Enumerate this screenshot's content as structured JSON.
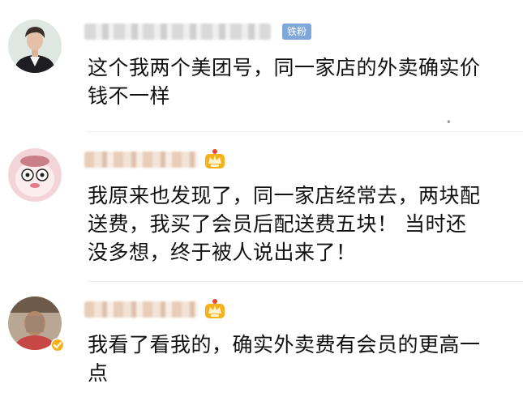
{
  "comments": [
    {
      "badge": "铁粉",
      "text_lines": [
        "这个我两个美团号，同一家店的外卖确实价",
        "钱不一样"
      ],
      "avatar_icon": "user-avatar-icon"
    },
    {
      "badge_icon": "vip-crown-icon",
      "text_lines": [
        "我原来也发现了，同一家店经常去，两块配",
        "送费，我买了会员后配送费五块！ 当时还",
        "没多想，终于被人说出来了！"
      ],
      "avatar_icon": "user-avatar-icon"
    },
    {
      "badge_icon": "vip-crown-icon",
      "verified_icon": "verified-badge-icon",
      "text_lines": [
        "我看了看我的，确实外卖费有会员的更高一",
        "点"
      ],
      "avatar_icon": "user-avatar-icon"
    }
  ],
  "colors": {
    "text": "#111111",
    "fan_badge": "#7fa7d9",
    "crown": "#f5b21b",
    "verified": "#f5b21b"
  }
}
